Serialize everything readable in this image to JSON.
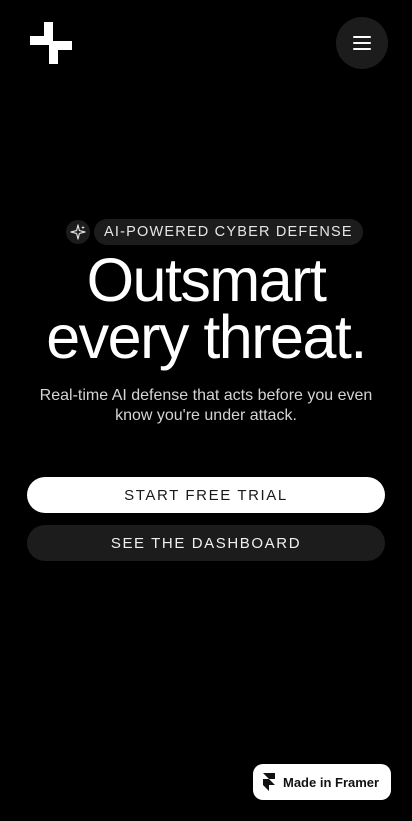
{
  "header": {
    "logo_icon": "plus-logo-icon",
    "menu_icon": "hamburger-menu-icon"
  },
  "hero": {
    "badge_icon": "sparkle-icon",
    "badge_label": "AI-POWERED CYBER DEFENSE",
    "headline_line1": "Outsmart",
    "headline_line2": "every threat.",
    "subtext": "Real-time AI defense that acts before you even know you're under attack."
  },
  "cta": {
    "primary_label": "START FREE TRIAL",
    "secondary_label": "SEE THE DASHBOARD"
  },
  "framer_badge": {
    "icon": "framer-logo-icon",
    "label": "Made in Framer"
  },
  "colors": {
    "background": "#000000",
    "surface": "#1c1c1c",
    "text": "#ffffff",
    "primary_button": "#ffffff"
  }
}
